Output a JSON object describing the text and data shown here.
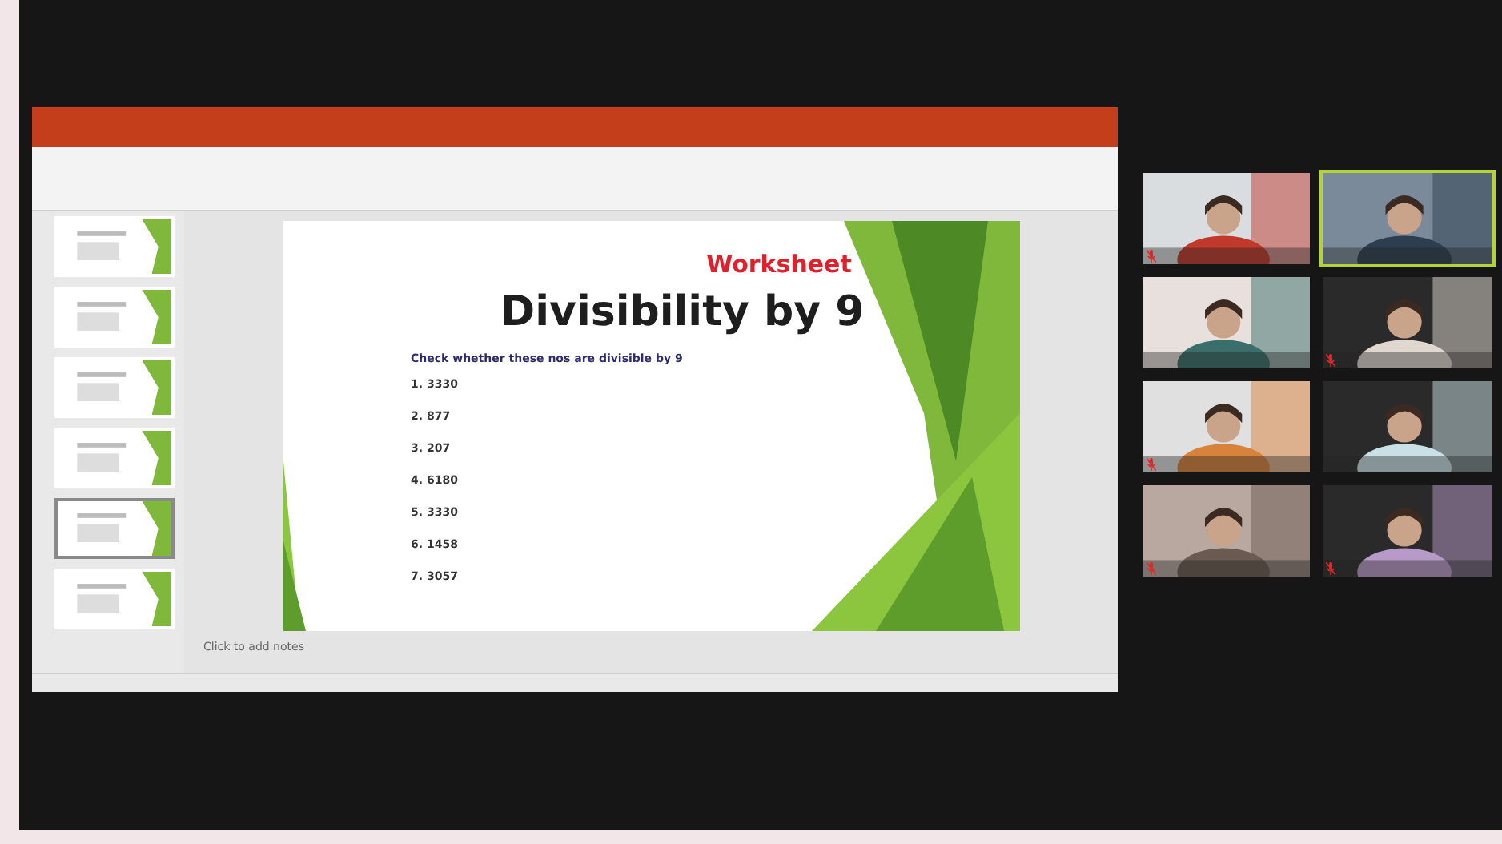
{
  "shared_screen": {
    "app_window": {
      "slide_thumbnails": [
        {
          "selected": false
        },
        {
          "selected": false
        },
        {
          "selected": false
        },
        {
          "selected": false
        },
        {
          "selected": true
        },
        {
          "selected": false
        }
      ],
      "slide": {
        "heading": "Worksheet",
        "title": "Divisibility by 9",
        "instruction": "Check whether these nos are divisible by 9",
        "questions": [
          {
            "number": "1.",
            "value": "3330"
          },
          {
            "number": "2.",
            "value": "877"
          },
          {
            "number": "3.",
            "value": "207"
          },
          {
            "number": "4.",
            "value": "6180"
          },
          {
            "number": "5.",
            "value": "3330"
          },
          {
            "number": "6.",
            "value": "1458"
          },
          {
            "number": "7.",
            "value": "3057"
          }
        ]
      },
      "notes_placeholder": "Click to add notes"
    }
  },
  "participants": [
    {
      "kind": "picture",
      "speaking": false,
      "muted": true
    },
    {
      "kind": "picture",
      "speaking": true,
      "muted": false
    },
    {
      "kind": "picture",
      "speaking": false,
      "muted": false
    },
    {
      "kind": "picture",
      "speaking": false,
      "muted": true
    },
    {
      "kind": "picture",
      "speaking": false,
      "muted": true
    },
    {
      "kind": "picture",
      "speaking": false,
      "muted": false
    },
    {
      "kind": "picture",
      "speaking": false,
      "muted": true
    },
    {
      "kind": "picture",
      "speaking": false,
      "muted": true
    }
  ]
}
